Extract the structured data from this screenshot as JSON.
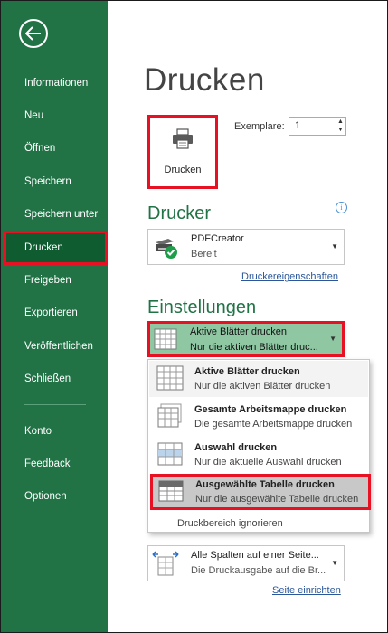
{
  "sidebar": {
    "items": [
      {
        "label": "Informationen"
      },
      {
        "label": "Neu"
      },
      {
        "label": "Öffnen"
      },
      {
        "label": "Speichern"
      },
      {
        "label": "Speichern unter"
      },
      {
        "label": "Drucken"
      },
      {
        "label": "Freigeben"
      },
      {
        "label": "Exportieren"
      },
      {
        "label": "Veröffentlichen"
      },
      {
        "label": "Schließen"
      },
      {
        "label": "Konto"
      },
      {
        "label": "Feedback"
      },
      {
        "label": "Optionen"
      }
    ],
    "active": "Drucken"
  },
  "main": {
    "title": "Drucken",
    "print_button_label": "Drucken",
    "copies_label": "Exemplare:",
    "copies_value": "1",
    "printer_section_title": "Drucker",
    "printer": {
      "name": "PDFCreator",
      "status": "Bereit"
    },
    "printer_properties_link": "Druckereigenschaften",
    "settings_section_title": "Einstellungen",
    "scope_dropdown": {
      "title": "Aktive Blätter drucken",
      "subtitle": "Nur die aktiven Blätter druc..."
    },
    "scope_menu": {
      "items": [
        {
          "title": "Aktive Blätter drucken",
          "subtitle": "Nur die aktiven Blätter drucken"
        },
        {
          "title": "Gesamte Arbeitsmappe drucken",
          "subtitle": "Die gesamte Arbeitsmappe drucken"
        },
        {
          "title": "Auswahl drucken",
          "subtitle": "Nur die aktuelle Auswahl drucken"
        },
        {
          "title": "Ausgewählte Tabelle drucken",
          "subtitle": "Nur die ausgewählte Tabelle drucken"
        }
      ],
      "footer": "Druckbereich ignorieren"
    },
    "scaling_dropdown": {
      "title": "Alle Spalten auf einer Seite...",
      "subtitle": "Die Druckausgabe auf die Br..."
    },
    "page_setup_link": "Seite einrichten"
  },
  "colors": {
    "accent": "#217346",
    "highlight": "#e81123",
    "link": "#2b579a"
  }
}
